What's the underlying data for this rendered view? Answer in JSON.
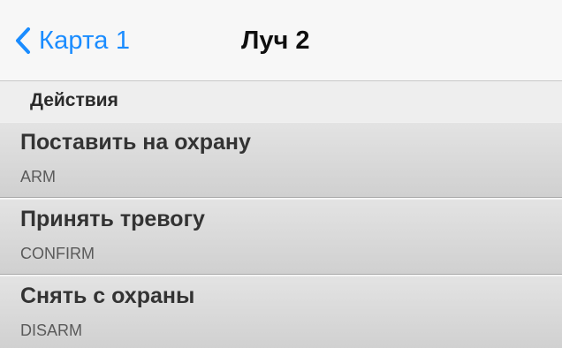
{
  "navbar": {
    "back_label": "Карта 1",
    "title": "Луч 2",
    "accent_color": "#1a8cff"
  },
  "section": {
    "header": "Действия"
  },
  "actions": [
    {
      "title": "Поставить на охрану",
      "subtitle": "ARM"
    },
    {
      "title": "Принять тревогу",
      "subtitle": "CONFIRM"
    },
    {
      "title": "Снять с охраны",
      "subtitle": "DISARM"
    }
  ]
}
